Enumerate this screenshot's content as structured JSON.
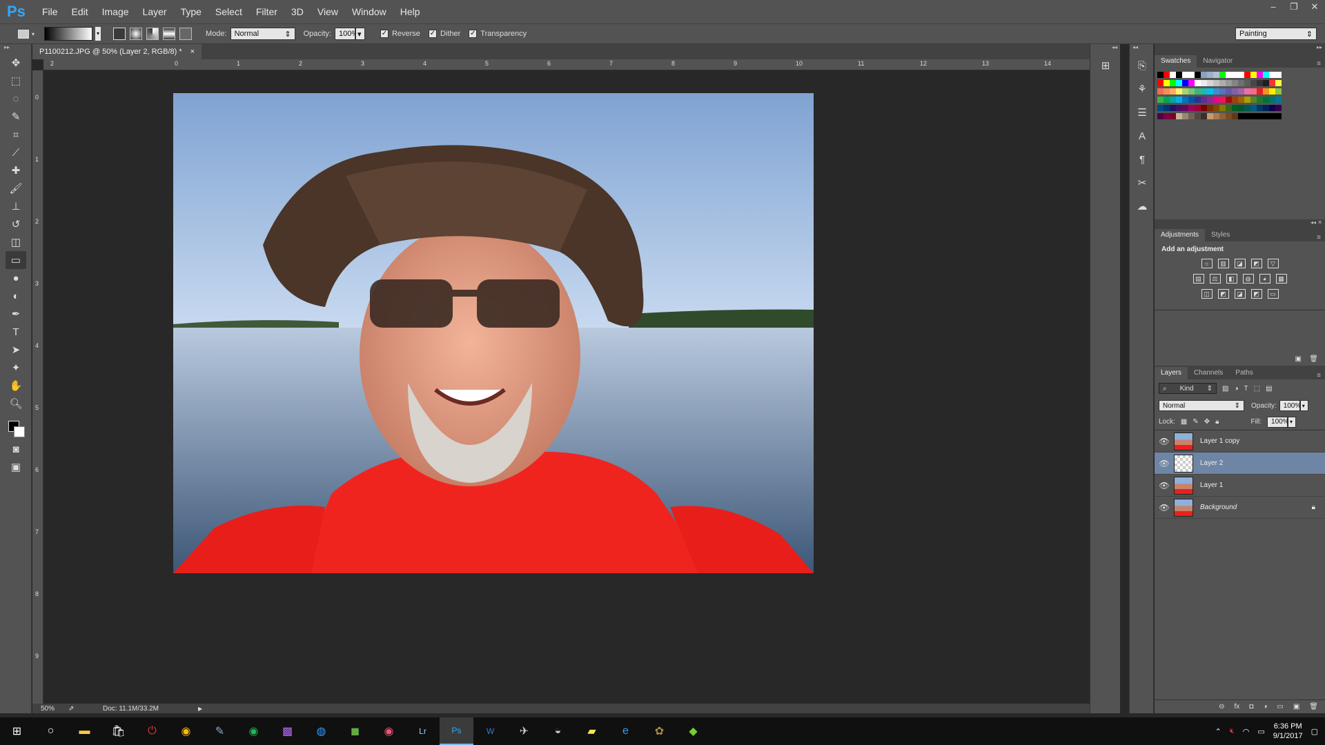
{
  "app": {
    "logo": "Ps"
  },
  "menu": [
    "File",
    "Edit",
    "Image",
    "Layer",
    "Type",
    "Select",
    "Filter",
    "3D",
    "View",
    "Window",
    "Help"
  ],
  "window_controls": {
    "minimize": "–",
    "restore": "❐",
    "close": "✕"
  },
  "options": {
    "mode_label": "Mode:",
    "mode_value": "Normal",
    "opacity_label": "Opacity:",
    "opacity_value": "100%",
    "reverse": "Reverse",
    "dither": "Dither",
    "transparency": "Transparency",
    "workspace": "Painting"
  },
  "document": {
    "tab": "P1100212.JPG @ 50% (Layer 2, RGB/8) *",
    "close": "×",
    "zoom": "50%",
    "doc_info": "Doc: 11.1M/33.2M"
  },
  "ruler_h": [
    "2",
    "0",
    "1",
    "2",
    "3",
    "4",
    "5",
    "6",
    "7",
    "8",
    "9",
    "10",
    "11",
    "12",
    "13",
    "14"
  ],
  "ruler_v": [
    "0",
    "1",
    "2",
    "3",
    "4",
    "5",
    "6",
    "7",
    "8",
    "9"
  ],
  "swatches_panel": {
    "tabs": [
      "Swatches",
      "Navigator"
    ],
    "colors": [
      "#000000",
      "#ff0000",
      "#ffffff",
      "#000000",
      "#ffffff",
      "#ffffff",
      "#000000",
      "#8aa2c0",
      "#9eb1c8",
      "#b0c2d6",
      "#00ff00",
      "#ffffff",
      "#ffffff",
      "#ffffff",
      "#ff0000",
      "#ffff00",
      "#ff00ff",
      "#00ffff",
      "#ffffff",
      "#ffffff",
      "#ff0000",
      "#ffff00",
      "#00ff00",
      "#00ffff",
      "#0000ff",
      "#ff00ff",
      "#ffffff",
      "#ebebeb",
      "#d6d6d6",
      "#c2c2c2",
      "#adadad",
      "#999999",
      "#858585",
      "#707070",
      "#5c5c5c",
      "#474747",
      "#333333",
      "#1f1f1f",
      "#ff3030",
      "#ffff40",
      "#f26c4f",
      "#f68e55",
      "#fbaf5c",
      "#fff467",
      "#acd372",
      "#7cc576",
      "#3bb878",
      "#1abbb4",
      "#00bff3",
      "#438ccb",
      "#5574b9",
      "#605ca8",
      "#855fa8",
      "#a763a8",
      "#f06ea9",
      "#f26d7d",
      "#ed1c24",
      "#f7941d",
      "#fff200",
      "#8dc63f",
      "#39b54a",
      "#00a651",
      "#00a99d",
      "#00aeef",
      "#0072bc",
      "#0054a6",
      "#2e3192",
      "#662d91",
      "#92278f",
      "#ec008c",
      "#ed145b",
      "#9e0b0f",
      "#a0410d",
      "#a36209",
      "#aba000",
      "#598527",
      "#197b30",
      "#007236",
      "#00746b",
      "#0076a3",
      "#004a80",
      "#003471",
      "#1b1464",
      "#440e62",
      "#630460",
      "#9e005d",
      "#9e0039",
      "#790000",
      "#7b2e00",
      "#7d4900",
      "#827b00",
      "#406618",
      "#005e20",
      "#005826",
      "#005952",
      "#005b7f",
      "#003663",
      "#002157",
      "#0d004c",
      "#32004b",
      "#4b0049",
      "#7b0046",
      "#7a0026",
      "#c7b299",
      "#998675",
      "#736357",
      "#534741",
      "#37302d",
      "#c69c6d",
      "#a67c52",
      "#8c6239",
      "#754c24",
      "#603913",
      "#000000",
      "#000000",
      "#000000",
      "#000000",
      "#000000",
      "#000000",
      "#000000"
    ]
  },
  "adjustments_panel": {
    "tabs": [
      "Adjustments",
      "Styles"
    ],
    "title": "Add an adjustment",
    "row1": [
      "☼",
      "▥",
      "◪",
      "◩",
      "▽"
    ],
    "row2": [
      "▤",
      "⚖",
      "◧",
      "◍",
      "◕",
      "▦"
    ],
    "row3": [
      "◫",
      "◩",
      "◪",
      "◩",
      "▭"
    ]
  },
  "layers_panel": {
    "tabs": [
      "Layers",
      "Channels",
      "Paths"
    ],
    "filter": "Kind",
    "blend": "Normal",
    "opacity_label": "Opacity:",
    "opacity_value": "100%",
    "lock_label": "Lock:",
    "fill_label": "Fill:",
    "fill_value": "100%",
    "layers": [
      {
        "name": "Layer 1 copy",
        "italic": false,
        "selected": false,
        "transparent": false
      },
      {
        "name": "Layer 2",
        "italic": false,
        "selected": true,
        "transparent": true
      },
      {
        "name": "Layer 1",
        "italic": false,
        "selected": false,
        "transparent": false
      },
      {
        "name": "Background",
        "italic": true,
        "selected": false,
        "transparent": false
      }
    ],
    "footer_icons": [
      "⊖",
      "fx",
      "◘",
      "◑",
      "▭",
      "▣",
      "🗑"
    ]
  },
  "taskbar": {
    "time": "6:36 PM",
    "date": "9/1/2017"
  }
}
